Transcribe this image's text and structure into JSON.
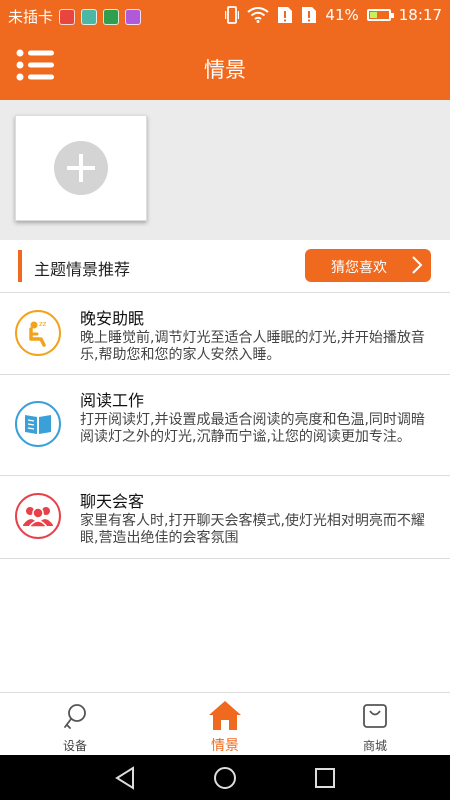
{
  "status_bar": {
    "carrier": "未插卡",
    "battery_percent": "41%",
    "battery_level": 0.41,
    "time": "18:17"
  },
  "app_bar": {
    "title": "情景"
  },
  "section": {
    "title": "主题情景推荐",
    "guess_button": "猜您喜欢"
  },
  "scenes": [
    {
      "title": "晚安助眠",
      "desc": "晚上睡觉前,调节灯光至适合人睡眠的灯光,并开始播放音乐,帮助您和您的家人安然入睡。",
      "color": "#f2a31b"
    },
    {
      "title": "阅读工作",
      "desc": "打开阅读灯,并设置成最适合阅读的亮度和色温,同时调暗阅读灯之外的灯光,沉静而宁谧,让您的阅读更加专注。",
      "color": "#3aa0d8"
    },
    {
      "title": "聊天会客",
      "desc": "家里有客人时,打开聊天会客模式,使灯光相对明亮而不耀眼,营造出绝佳的会客氛围",
      "color": "#e8414a"
    }
  ],
  "bottom_nav": [
    {
      "label": "设备",
      "icon": "bulb-icon"
    },
    {
      "label": "情景",
      "icon": "home-icon",
      "active": true
    },
    {
      "label": "商城",
      "icon": "shopping-bag-icon"
    }
  ],
  "colors": {
    "accent": "#ef6a1f"
  }
}
